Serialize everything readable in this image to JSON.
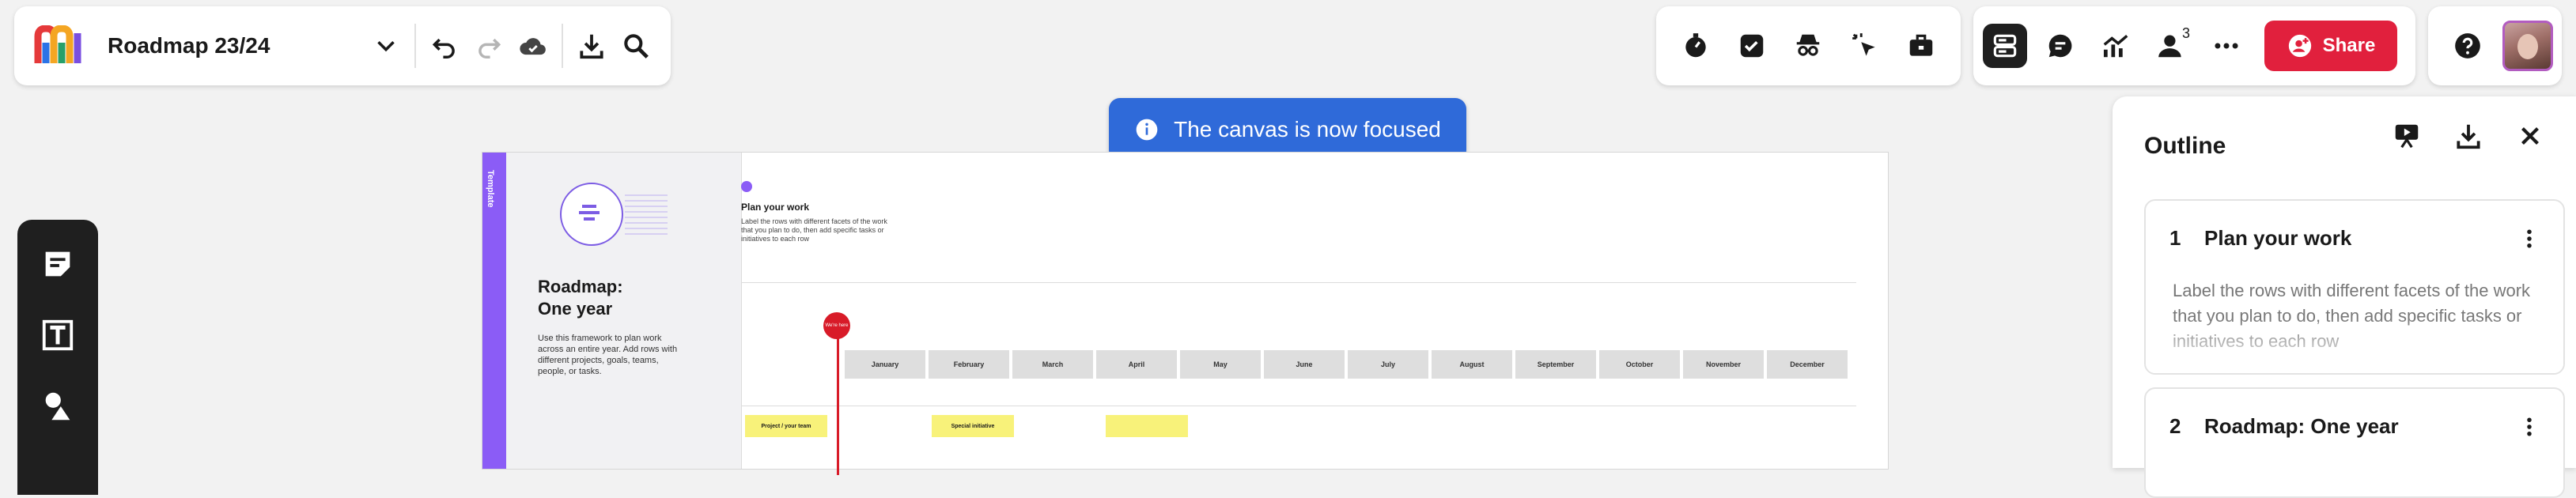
{
  "board": {
    "title": "Roadmap 23/24"
  },
  "toast": {
    "text": "The canvas is now focused"
  },
  "collab": {
    "share_label": "Share",
    "online_count": "3"
  },
  "template": {
    "tag": "Template",
    "title": "Roadmap:\nOne year",
    "description": "Use this framework to plan work across an entire year. Add rows with different projects, goals, teams, people, or tasks."
  },
  "frame": {
    "section_title": "Plan your work",
    "section_desc": "Label the rows with different facets of the work that you plan to do, then add specific tasks or initiatives to each row",
    "now_label": "We're here",
    "months": [
      "January",
      "February",
      "March",
      "April",
      "May",
      "June",
      "July",
      "August",
      "September",
      "October",
      "November",
      "December"
    ],
    "stickies": [
      {
        "label": "Project / your team"
      },
      {
        "label": "Special initiative"
      },
      {
        "label": ""
      }
    ]
  },
  "outline": {
    "title": "Outline",
    "items": [
      {
        "num": "1",
        "title": "Plan your work",
        "desc": "Label the rows with different facets of the work that you plan to do, then add specific tasks or initiatives to each row"
      },
      {
        "num": "2",
        "title": "Roadmap: One year",
        "desc": ""
      }
    ]
  },
  "colors": {
    "accent": "#2f6ad9",
    "share": "#e1203d",
    "template": "#8b5cf6",
    "now": "#d81b28",
    "sticky": "#f8f27a"
  }
}
